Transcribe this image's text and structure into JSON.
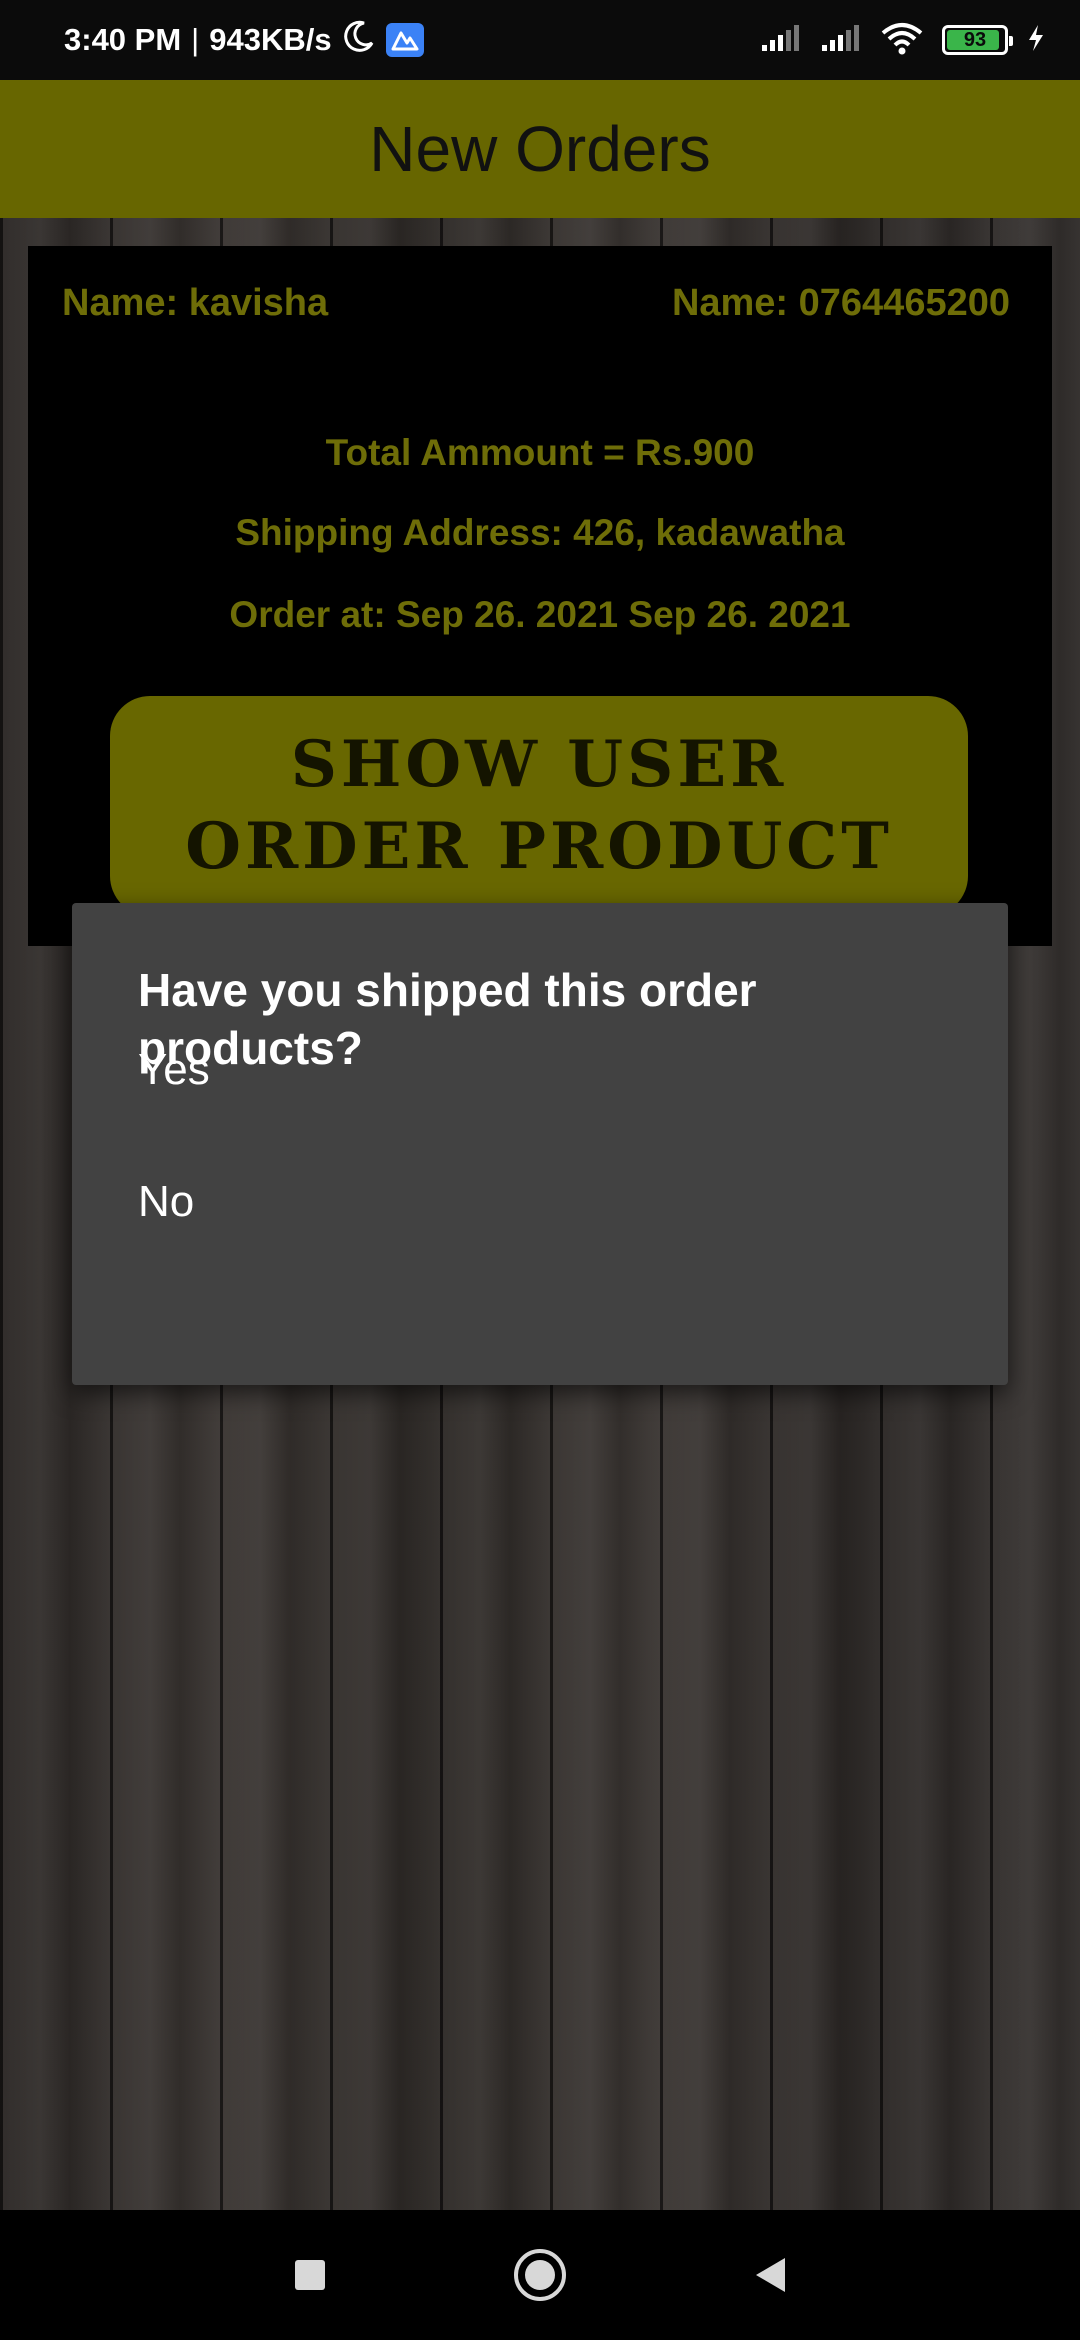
{
  "status_bar": {
    "time": "3:40 PM",
    "separator": "|",
    "network_speed": "943KB/s",
    "battery_level": "93",
    "battery_fraction": 0.93,
    "icons": [
      "moon-icon",
      "app-badge-icon",
      "signal-icon",
      "signal-icon",
      "wifi-icon",
      "battery-icon",
      "charging-icon"
    ]
  },
  "app_bar": {
    "title": "New Orders",
    "color": "#676600"
  },
  "order": {
    "name_label": "Name: kavisha",
    "phone_label": "Name: 0764465200",
    "total": "Total Ammount = Rs.900",
    "shipping_address": "Shipping Address: 426, kadawatha",
    "order_at": "Order at: Sep 26. 2021 Sep 26. 2021",
    "show_button_label": "SHOW USER ORDER PRODUCT",
    "text_color": "#6e6d08",
    "button_color": "#686700"
  },
  "dialog": {
    "title": "Have you shipped this order products?",
    "options": [
      "Yes",
      "No"
    ],
    "background": "#424242"
  },
  "nav_bar": {
    "buttons": [
      "recents-square-icon",
      "home-circle-icon",
      "back-triangle-icon"
    ]
  }
}
